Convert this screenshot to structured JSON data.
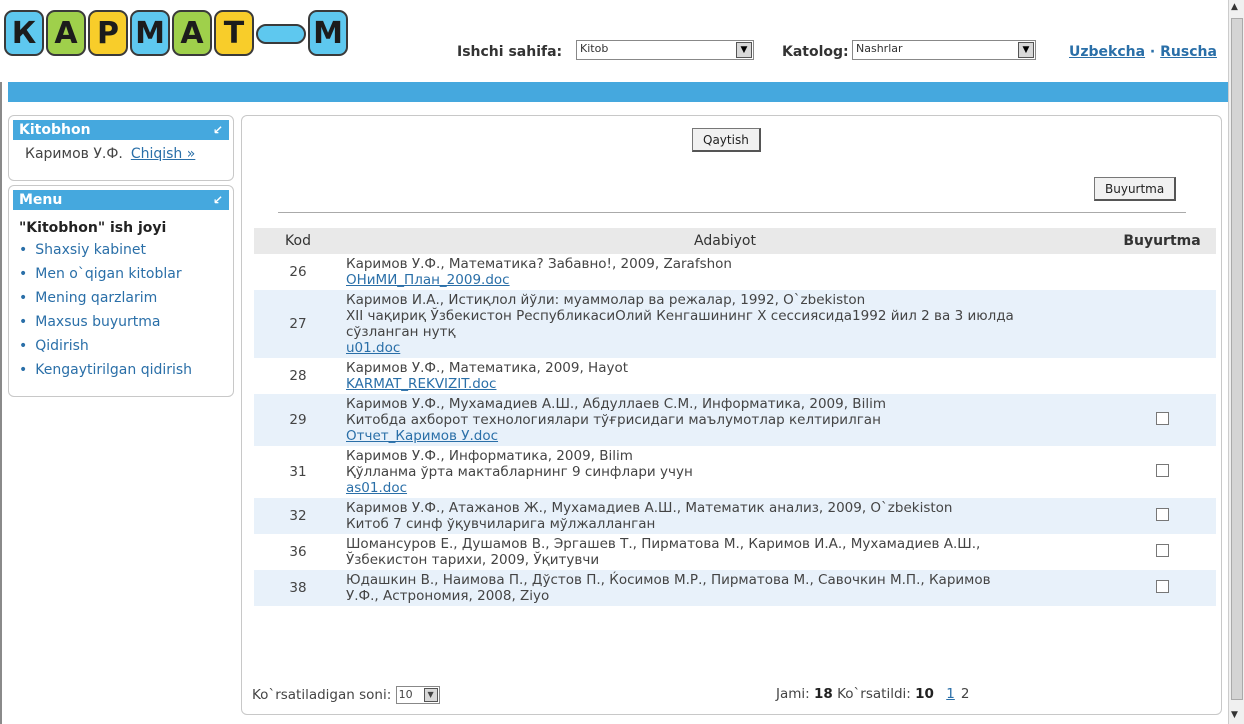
{
  "logo": {
    "letters": [
      "К",
      "А",
      "Р",
      "М",
      "А",
      "Т",
      "",
      "М"
    ]
  },
  "header": {
    "workpage_label": "Ishchi sahifa:",
    "workpage_value": "Kitob",
    "catalog_label": "Katolog:",
    "catalog_value": "Nashrlar",
    "lang_uz": "Uzbekcha",
    "lang_sep": " · ",
    "lang_ru": "Ruscha"
  },
  "sidebar": {
    "reader_title": "Kitobhon",
    "user_name": "Каримов У.Ф.",
    "logout": "Chiqish »",
    "menu_title": "Menu",
    "workplace_title": "\"Kitobhon\" ish joyi",
    "items": [
      "Shaxsiy kabinet",
      "Men o`qigan kitoblar",
      "Mening qarzlarim",
      "Maxsus buyurtma",
      "Qidirish",
      "Kengaytirilgan qidirish"
    ]
  },
  "main": {
    "back_button": "Qaytish",
    "order_button": "Buyurtma",
    "columns": [
      "Kod",
      "Adabiyot",
      "Buyurtma"
    ],
    "rows": [
      {
        "code": "26",
        "lines": [
          "Каримов У.Ф., Математика? Забавно!, 2009, Zarafshon"
        ],
        "file": "ОНиМИ_План_2009.doc",
        "checkbox": false
      },
      {
        "code": "27",
        "lines": [
          "Каримов И.А., Истиқлол йўли: муаммолар ва режалар, 1992, O`zbekiston",
          "XII чақириқ Ўзбекистон РеспубликасиОлий Кенгашининг Х сессиясида1992 йил 2 ва 3 июлда",
          "сўзланган нутқ"
        ],
        "file": "u01.doc",
        "checkbox": false
      },
      {
        "code": "28",
        "lines": [
          "Каримов У.Ф., Математика, 2009, Hayot"
        ],
        "file": "KARMAT_REKVIZIT.doc",
        "checkbox": false
      },
      {
        "code": "29",
        "lines": [
          "Каримов У.Ф., Мухамадиев А.Ш., Абдуллаев С.М., Информатика, 2009, Bilim",
          "Китобда ахборот технологиялари тўғрисидаги маълумотлар келтирилган"
        ],
        "file": "Отчет_Каримов У.doc",
        "checkbox": true
      },
      {
        "code": "31",
        "lines": [
          "Каримов У.Ф., Информатика, 2009, Bilim",
          "Қўлланма ўрта мактабларнинг 9 синфлари учун"
        ],
        "file": "as01.doc",
        "checkbox": true
      },
      {
        "code": "32",
        "lines": [
          "Каримов У.Ф., Атажанов Ж., Мухамадиев А.Ш., Математик анализ, 2009, O`zbekiston",
          "Китоб 7 синф ўқувчиларига мўлжалланган"
        ],
        "file": "",
        "checkbox": true
      },
      {
        "code": "36",
        "lines": [
          "Шомансуров Е., Душамов В., Эргашев Т., Пирматова М., Каримов И.А., Мухамадиев А.Ш.,",
          "Ўзбекистон тарихи, 2009, Ўқитувчи"
        ],
        "file": "",
        "checkbox": true
      },
      {
        "code": "38",
        "lines": [
          "Юдашкин В., Наимова П., Дўстов П., Ќосимов М.Р., Пирматова М., Савочкин М.П., Каримов",
          "У.Ф., Астрономия, 2008, Ziyo"
        ],
        "file": "",
        "checkbox": true
      }
    ],
    "show_count_label": "Ko`rsatiladigan soni:",
    "show_count_value": "10",
    "total_label": "Jami:",
    "total_value": "18",
    "shown_label": "Ko`rsatildi:",
    "shown_value": "10",
    "pages": [
      "1",
      "2"
    ]
  }
}
